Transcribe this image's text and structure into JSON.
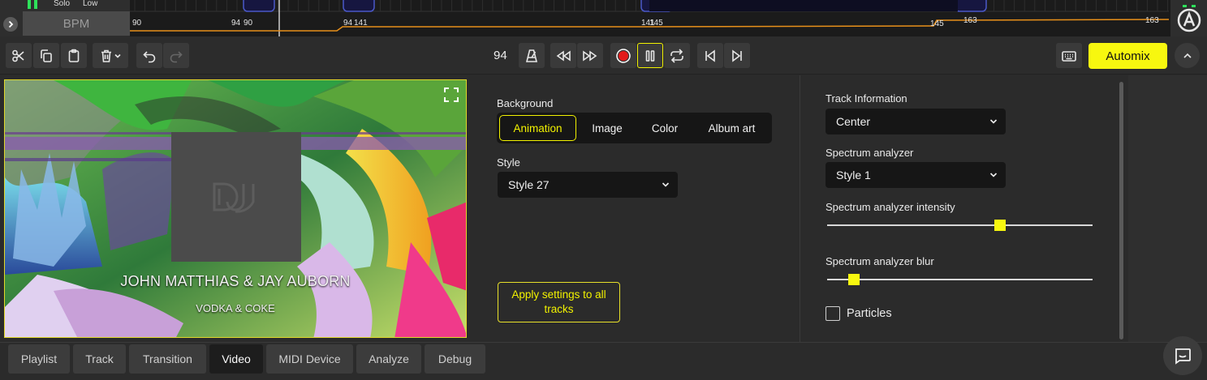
{
  "timeline": {
    "solo_label": "Solo",
    "low_label": "Low",
    "bpm_label": "BPM",
    "bpm_markers": [
      "90",
      "94",
      "90",
      "94",
      "141",
      "141",
      "145",
      "145",
      "163",
      "163"
    ]
  },
  "toolbar": {
    "bpm_value": "94",
    "automix_label": "Automix"
  },
  "preview": {
    "artist": "JOHN MATTHIAS & JAY AUBORN",
    "title": "VODKA & COKE"
  },
  "settings": {
    "background_label": "Background",
    "background_options": [
      "Animation",
      "Image",
      "Color",
      "Album art"
    ],
    "background_selected": "Animation",
    "style_label": "Style",
    "style_value": "Style 27",
    "apply_label": "Apply settings to all tracks",
    "track_info_label": "Track Information",
    "track_info_value": "Center",
    "spectrum_label": "Spectrum analyzer",
    "spectrum_value": "Style 1",
    "intensity_label": "Spectrum analyzer intensity",
    "intensity_level": 0.65,
    "blur_label": "Spectrum analyzer blur",
    "blur_level": 0.1,
    "particles_label": "Particles",
    "particles_checked": false
  },
  "tabs": [
    "Playlist",
    "Track",
    "Transition",
    "Video",
    "MIDI Device",
    "Analyze",
    "Debug"
  ],
  "active_tab": "Video",
  "colors": {
    "accent": "#f7f70f",
    "bpm_curve": "#e8901a",
    "panel_bg": "#2b2b2b",
    "field_bg": "#161616"
  }
}
